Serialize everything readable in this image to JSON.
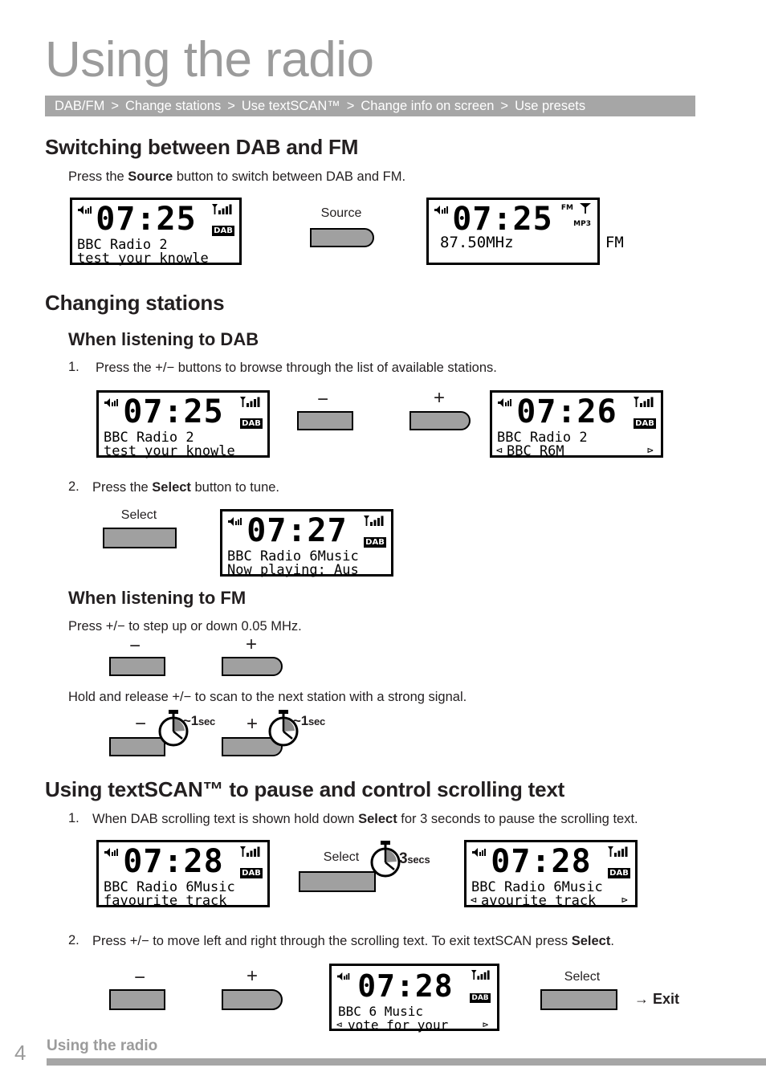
{
  "header": {
    "title": "Using the radio",
    "breadcrumb": [
      "DAB/FM",
      "Change stations",
      "Use textSCAN™",
      "Change info on screen",
      "Use presets"
    ],
    "separator": ">"
  },
  "sections": {
    "switching": {
      "heading": "Switching between DAB and FM",
      "intro_pre": "Press the ",
      "intro_bold": "Source",
      "intro_post": " button to switch between DAB and FM."
    },
    "changing": {
      "heading": "Changing stations",
      "dab_sub": "When listening to DAB",
      "dab_step1_num": "1.",
      "dab_step1_text": "Press the  +/−  buttons to browse through the list of available stations.",
      "dab_step2_num": "2.",
      "dab_step2_pre": "Press the ",
      "dab_step2_bold": "Select",
      "dab_step2_post": " button to tune.",
      "fm_sub": "When listening to FM",
      "fm_step_text": "Press  +/−  to step up or down 0.05 MHz.",
      "fm_hold_text": "Hold and release  +/−  to scan to the next station with a strong signal."
    },
    "textscan": {
      "heading": "Using textSCAN™ to pause and control scrolling text",
      "step1_num": "1.",
      "step1_pre": "When DAB scrolling text is shown hold down ",
      "step1_bold": "Select",
      "step1_post": " for 3 seconds to pause the scrolling text.",
      "step2_num": "2.",
      "step2_pre": "Press  +/−  to move left and right through the scrolling text. To exit textSCAN press ",
      "step2_bold": "Select",
      "step2_post": "."
    }
  },
  "buttons": {
    "source": "Source",
    "select": "Select",
    "minus": "−",
    "plus": "+",
    "exit": "→ Exit",
    "exit_arrow": "→",
    "exit_word": "Exit"
  },
  "timers": {
    "one_sec_tilde": "~1",
    "one_sec_unit": "sec",
    "three_secs_num": "3",
    "three_secs_unit": "secs"
  },
  "displays": {
    "dab_1": {
      "time": "07:25",
      "mode": "DAB",
      "line1": "BBC Radio 2",
      "line2": "test your knowle",
      "left_marker": "",
      "right_marker": ""
    },
    "fm_1": {
      "time": "07:25",
      "mode": "FM",
      "flag_fm": "FM",
      "flag_mp3": "MP3",
      "line1": "87.50MHz          FM",
      "line2": ""
    },
    "dab_2": {
      "time": "07:25",
      "mode": "DAB",
      "line1": "BBC Radio 2",
      "line2": "test your knowle"
    },
    "dab_3": {
      "time": "07:26",
      "mode": "DAB",
      "line1": "BBC Radio 2",
      "line2": "BBC R6M",
      "left_marker": "⊲",
      "right_marker": "⊳"
    },
    "dab_4": {
      "time": "07:27",
      "mode": "DAB",
      "line1": "BBC Radio 6Music",
      "line2": "Now playing: Aus"
    },
    "dab_5": {
      "time": "07:28",
      "mode": "DAB",
      "line1": "BBC Radio 6Music",
      "line2": "favourite track"
    },
    "dab_6": {
      "time": "07:28",
      "mode": "DAB",
      "line1": "BBC Radio 6Music",
      "line2": "avourite track",
      "left_marker": "⊲",
      "right_marker": "⊳"
    },
    "dab_7": {
      "time": "07:28",
      "mode": "DAB",
      "line1": "BBC 6 Music",
      "line2": "vote for your",
      "left_marker": "⊲",
      "right_marker": "⊳"
    }
  },
  "footer": {
    "page_number": "4",
    "text": "Using the radio"
  },
  "colors": {
    "title_gray": "#9b9b9b",
    "bar_gray": "#a6a6a6",
    "button_gray": "#a0a0a0",
    "ink": "#231f20"
  }
}
